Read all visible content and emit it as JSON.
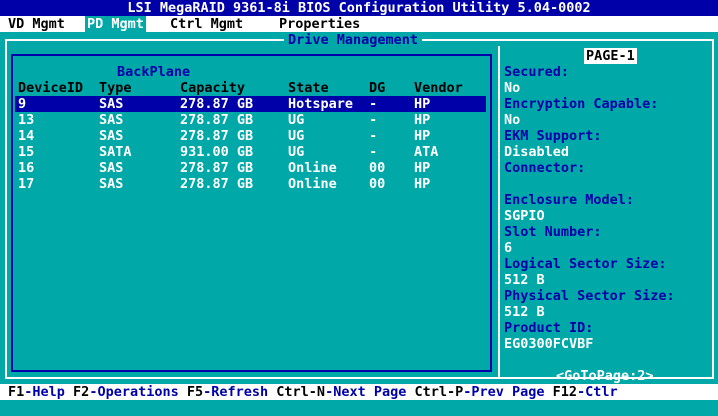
{
  "title": "LSI MegaRAID 9361-8i BIOS Configuration Utility 5.04-0002",
  "menu": [
    {
      "label": "VD Mgmt"
    },
    {
      "label": "PD Mgmt"
    },
    {
      "label": "Ctrl Mgmt"
    },
    {
      "label": "Properties"
    }
  ],
  "panel_title": "Drive Management",
  "backplane_label": "BackPlane",
  "table": {
    "headers": {
      "device": "DeviceID",
      "type": "Type",
      "capacity": "Capacity",
      "state": "State",
      "dg": "DG",
      "vendor": "Vendor"
    },
    "rows": [
      {
        "device": "9",
        "type": "SAS",
        "capacity": "278.87 GB",
        "state": "Hotspare",
        "dg": "-",
        "vendor": "HP"
      },
      {
        "device": "13",
        "type": "SAS",
        "capacity": "278.87 GB",
        "state": "UG",
        "dg": "-",
        "vendor": "HP"
      },
      {
        "device": "14",
        "type": "SAS",
        "capacity": "278.87 GB",
        "state": "UG",
        "dg": "-",
        "vendor": "HP"
      },
      {
        "device": "15",
        "type": "SATA",
        "capacity": "931.00 GB",
        "state": "UG",
        "dg": "-",
        "vendor": "ATA"
      },
      {
        "device": "16",
        "type": "SAS",
        "capacity": "278.87 GB",
        "state": "Online",
        "dg": "00",
        "vendor": "HP"
      },
      {
        "device": "17",
        "type": "SAS",
        "capacity": "278.87 GB",
        "state": "Online",
        "dg": "00",
        "vendor": "HP"
      }
    ]
  },
  "properties": {
    "page": "PAGE-1",
    "secured_label": "Secured:",
    "secured_value": "No",
    "encryption_label": "Encryption Capable:",
    "encryption_value": "No",
    "ekm_label": "EKM Support:",
    "ekm_value": "Disabled",
    "connector_label": "Connector:",
    "enclosure_label": "Enclosure Model:",
    "enclosure_value": "SGPIO",
    "slot_label": "Slot Number:",
    "slot_value": "6",
    "lss_label": "Logical Sector Size:",
    "lss_value": "512 B",
    "pss_label": "Physical Sector Size:",
    "pss_value": "512 B",
    "product_label": "Product ID:",
    "product_value": "EG0300FCVBF",
    "goto": "<GoToPage:2>"
  },
  "statusbar": {
    "f1_key": "F1",
    "f1_text": "-Help ",
    "f2_key": "F2",
    "f2_text": "-Operations ",
    "f5_key": "F5",
    "f5_text": "-Refresh ",
    "ctrln_key": "Ctrl-N",
    "ctrln_text": "-Next Page ",
    "ctrlp_key": "Ctrl-P",
    "ctrlp_text": "-Prev Page ",
    "f12_key": "F12",
    "f12_text": "-Ctlr"
  },
  "colors": {
    "background": "#00a8a8",
    "title_bar": "#0000a8",
    "selection": "#0000a8",
    "label_text": "#0000a8",
    "value_text": "#ffffff"
  }
}
